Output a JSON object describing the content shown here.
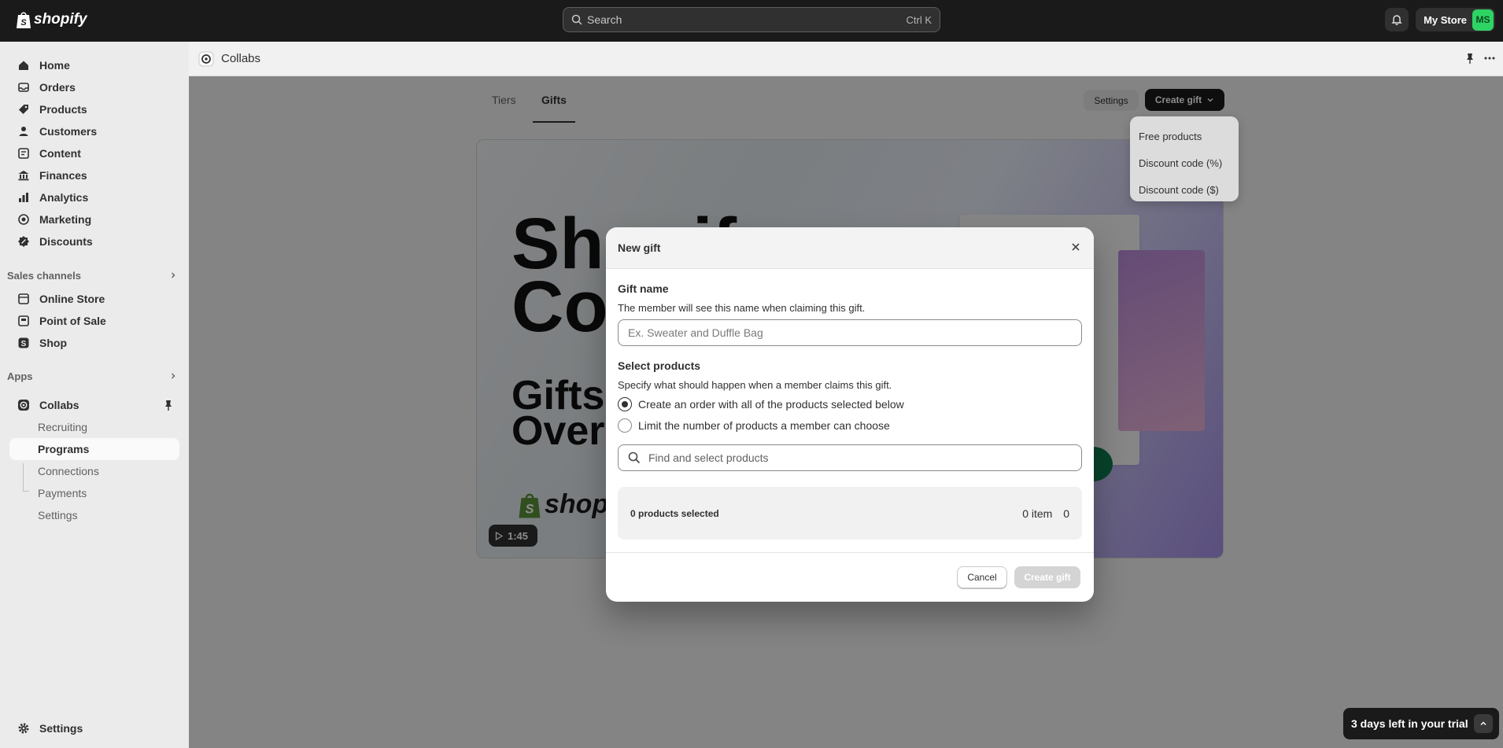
{
  "topbar": {
    "brand": "shopify",
    "search_placeholder": "Search",
    "search_shortcut": "Ctrl K",
    "store_name": "My Store",
    "avatar_initials": "MS",
    "avatar_color": "#2dd463"
  },
  "sidebar": {
    "main_items": [
      {
        "label": "Home",
        "icon": "home-icon"
      },
      {
        "label": "Orders",
        "icon": "inbox-icon"
      },
      {
        "label": "Products",
        "icon": "tag-icon"
      },
      {
        "label": "Customers",
        "icon": "person-icon"
      },
      {
        "label": "Content",
        "icon": "document-icon"
      },
      {
        "label": "Finances",
        "icon": "bank-icon"
      },
      {
        "label": "Analytics",
        "icon": "chart-icon"
      },
      {
        "label": "Marketing",
        "icon": "target-icon"
      },
      {
        "label": "Discounts",
        "icon": "discount-icon"
      }
    ],
    "sales_channels_label": "Sales channels",
    "sales_channels": [
      {
        "label": "Online Store",
        "icon": "store-icon"
      },
      {
        "label": "Point of Sale",
        "icon": "pos-icon"
      },
      {
        "label": "Shop",
        "icon": "shop-icon"
      }
    ],
    "apps_label": "Apps",
    "app_name": "Collabs",
    "app_subitems": [
      "Recruiting",
      "Programs",
      "Connections",
      "Payments",
      "Settings"
    ],
    "active_subitem": "Programs",
    "settings_label": "Settings"
  },
  "app_header": {
    "title": "Collabs"
  },
  "page": {
    "tabs": [
      "Tiers",
      "Gifts"
    ],
    "active_tab": "Gifts",
    "settings_button": "Settings",
    "create_gift_button": "Create gift",
    "create_gift_menu": [
      "Free products",
      "Discount code (%)",
      "Discount code ($)"
    ],
    "video": {
      "line1": "Shopif",
      "line2": "Co",
      "line3": "Gifts",
      "line4": "Over",
      "brand": "shopif",
      "duration": "1:45"
    }
  },
  "modal": {
    "title": "New gift",
    "gift_name_title": "Gift name",
    "gift_name_help": "The member will see this name when claiming this gift.",
    "gift_name_placeholder": "Ex. Sweater and Duffle Bag",
    "gift_name_value": "",
    "select_products_title": "Select products",
    "select_products_help": "Specify what should happen when a member claims this gift.",
    "radio_options": [
      {
        "label": "Create an order with all of the products selected below",
        "checked": true
      },
      {
        "label": "Limit the number of products a member can choose",
        "checked": false
      }
    ],
    "find_placeholder": "Find and select products",
    "summary_left": "0 products selected",
    "summary_items": "0 item",
    "summary_count": "0",
    "cancel_button": "Cancel",
    "create_button": "Create gift"
  },
  "trial_banner": {
    "text": "3 days left in your trial"
  }
}
